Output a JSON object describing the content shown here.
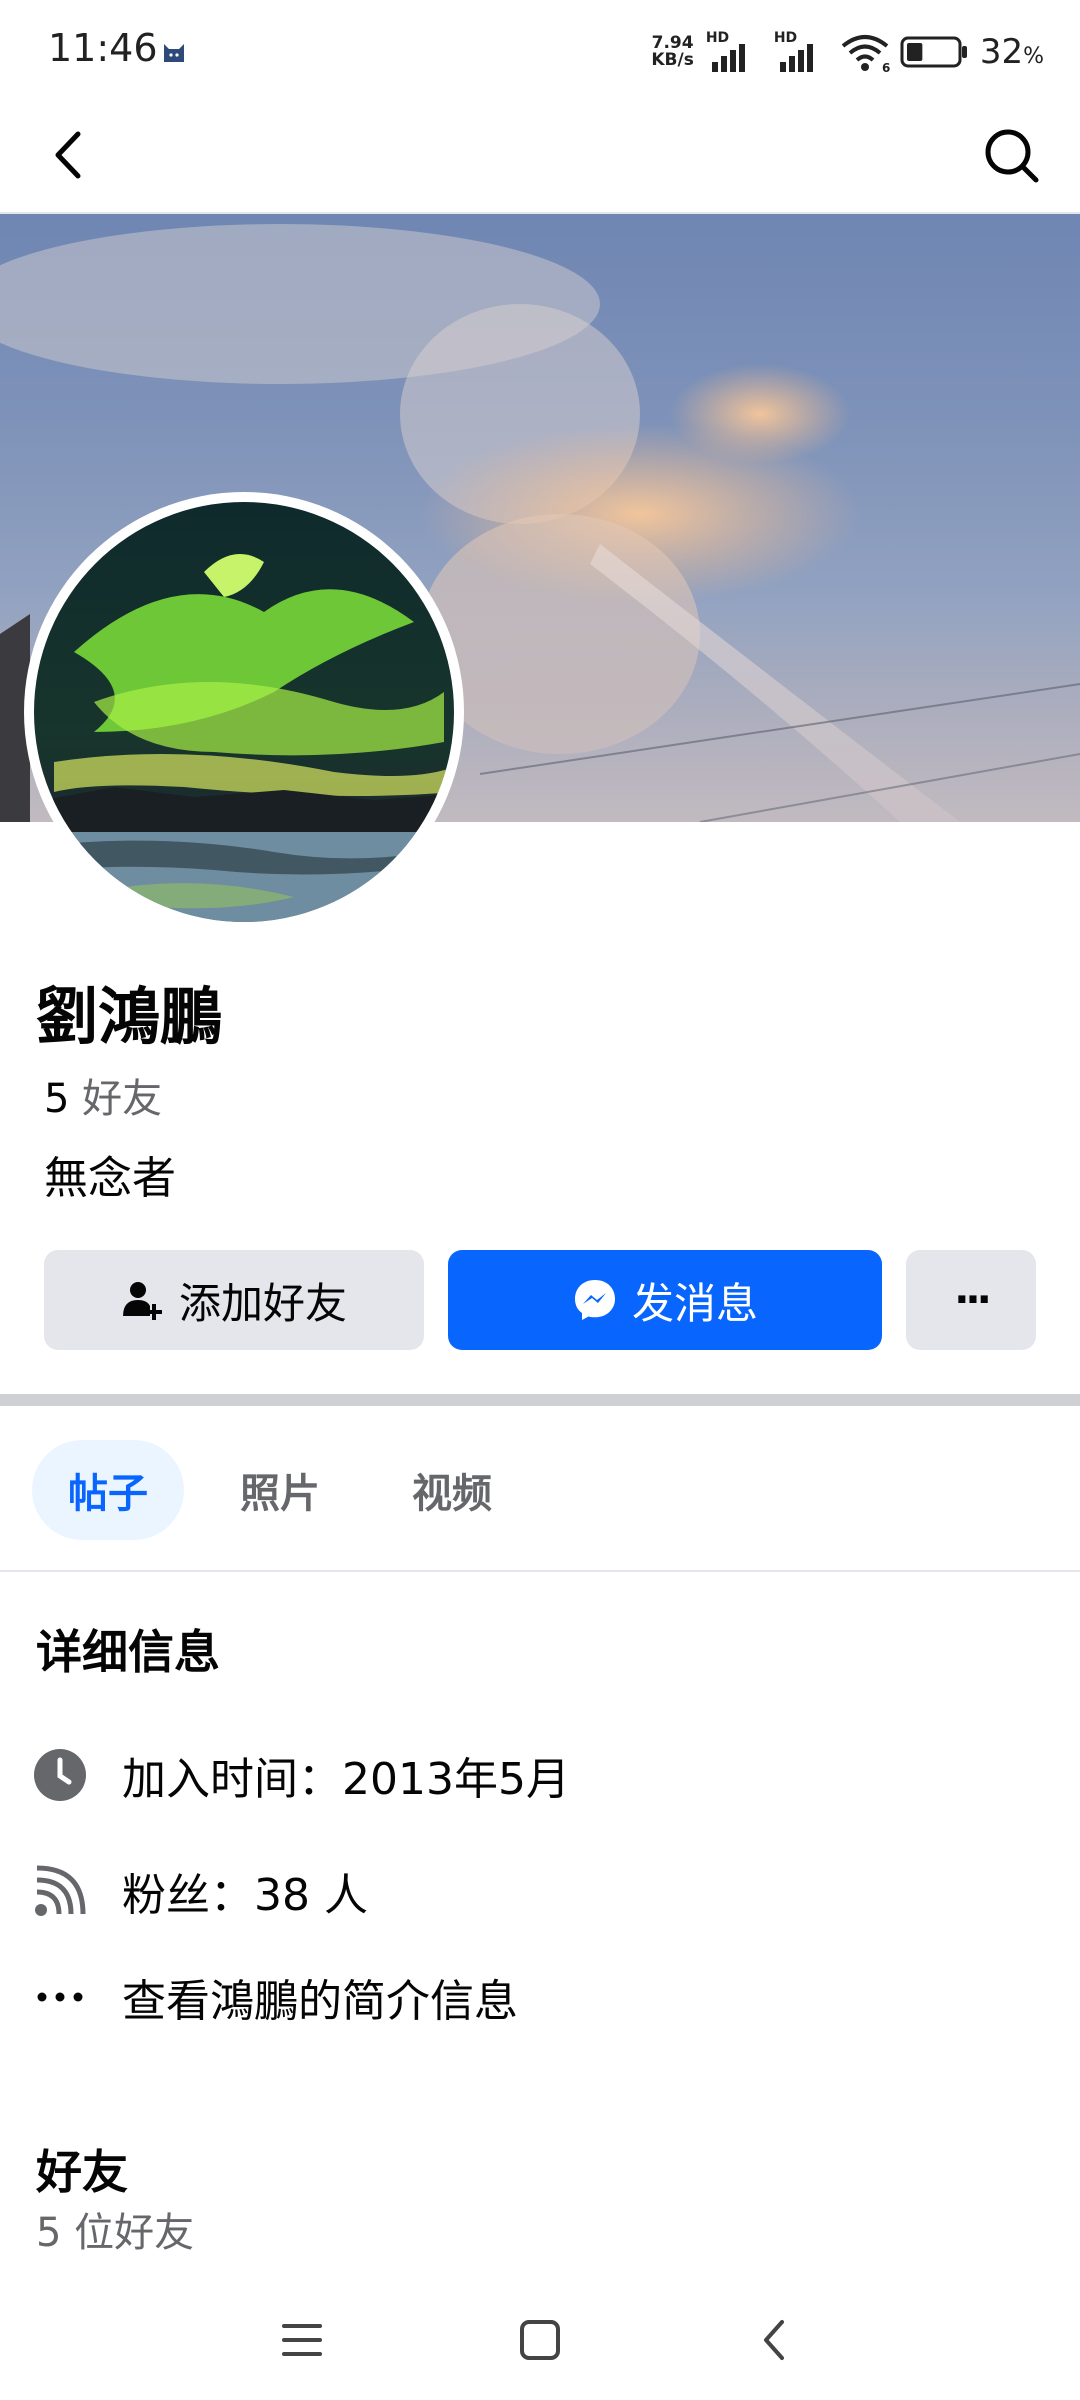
{
  "status_bar": {
    "time": "11:46",
    "net_speed_value": "7.94",
    "net_speed_unit": "KB/s",
    "hd_label": "HD",
    "wifi_badge": "6",
    "battery_percent": "32",
    "battery_percent_sign": "%",
    "battery_level": 0.32
  },
  "header": {
    "back_icon": "chevron-left-icon",
    "search_icon": "search-icon"
  },
  "profile": {
    "name": "劉鴻鵬",
    "friends_number": "5",
    "friends_suffix": "好友",
    "bio": "無念者"
  },
  "actions": {
    "add_friend_label": "添加好友",
    "message_label": "发消息",
    "more_label": "···"
  },
  "tabs": [
    {
      "label": "帖子",
      "active": true
    },
    {
      "label": "照片",
      "active": false
    },
    {
      "label": "视频",
      "active": false
    }
  ],
  "details": {
    "title": "详细信息",
    "items": [
      {
        "icon": "clock-icon",
        "text": "加入时间：2013年5月"
      },
      {
        "icon": "rss-followers-icon",
        "text": "粉丝：38 人"
      },
      {
        "icon": "more-dots-icon",
        "text": "查看鴻鵬的简介信息"
      }
    ]
  },
  "friends": {
    "title": "好友",
    "count_text": "5 位好友"
  },
  "colors": {
    "accent": "#0866ff",
    "secondary_button": "#e4e6eb",
    "muted_text": "#65676b",
    "active_tab_bg": "#ebf5ff"
  }
}
